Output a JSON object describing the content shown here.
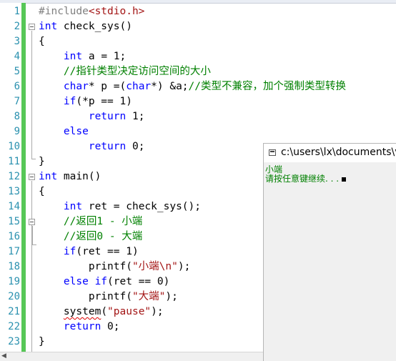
{
  "editor": {
    "line_numbers": [
      "1",
      "2",
      "3",
      "4",
      "5",
      "6",
      "7",
      "8",
      "9",
      "10",
      "11",
      "12",
      "13",
      "14",
      "15",
      "16",
      "17",
      "18",
      "19",
      "20",
      "21",
      "22",
      "23"
    ],
    "lines": [
      [
        {
          "t": "#include",
          "c": "pp"
        },
        {
          "t": "<stdio.h>",
          "c": "str"
        }
      ],
      [
        {
          "t": "int",
          "c": "kw"
        },
        {
          "t": " check_sys()",
          "c": ""
        }
      ],
      [
        {
          "t": "{",
          "c": ""
        }
      ],
      [
        {
          "t": "    ",
          "c": ""
        },
        {
          "t": "int",
          "c": "kw"
        },
        {
          "t": " a = 1;",
          "c": ""
        }
      ],
      [
        {
          "t": "    //指针类型决定访问空间的大小",
          "c": "cm"
        }
      ],
      [
        {
          "t": "    ",
          "c": ""
        },
        {
          "t": "char",
          "c": "kw"
        },
        {
          "t": "* p =(",
          "c": ""
        },
        {
          "t": "char",
          "c": "kw"
        },
        {
          "t": "*) &a;",
          "c": ""
        },
        {
          "t": "//类型不兼容，加个强制类型转换",
          "c": "cm"
        }
      ],
      [
        {
          "t": "    ",
          "c": ""
        },
        {
          "t": "if",
          "c": "kw"
        },
        {
          "t": "(*p == 1)",
          "c": ""
        }
      ],
      [
        {
          "t": "        ",
          "c": ""
        },
        {
          "t": "return",
          "c": "kw"
        },
        {
          "t": " 1;",
          "c": ""
        }
      ],
      [
        {
          "t": "    ",
          "c": ""
        },
        {
          "t": "else",
          "c": "kw"
        }
      ],
      [
        {
          "t": "        ",
          "c": ""
        },
        {
          "t": "return",
          "c": "kw"
        },
        {
          "t": " 0;",
          "c": ""
        }
      ],
      [
        {
          "t": "}",
          "c": ""
        }
      ],
      [
        {
          "t": "int",
          "c": "kw"
        },
        {
          "t": " main()",
          "c": ""
        }
      ],
      [
        {
          "t": "{",
          "c": ""
        }
      ],
      [
        {
          "t": "    ",
          "c": ""
        },
        {
          "t": "int",
          "c": "kw"
        },
        {
          "t": " ret = check_sys();",
          "c": ""
        }
      ],
      [
        {
          "t": "    //返回1 - 小端",
          "c": "cm"
        }
      ],
      [
        {
          "t": "    //返回0 - 大端",
          "c": "cm"
        }
      ],
      [
        {
          "t": "    ",
          "c": ""
        },
        {
          "t": "if",
          "c": "kw"
        },
        {
          "t": "(ret == 1)",
          "c": ""
        }
      ],
      [
        {
          "t": "        printf(",
          "c": ""
        },
        {
          "t": "\"小端\\n\"",
          "c": "str"
        },
        {
          "t": ");",
          "c": ""
        }
      ],
      [
        {
          "t": "    ",
          "c": ""
        },
        {
          "t": "else",
          "c": "kw"
        },
        {
          "t": " ",
          "c": ""
        },
        {
          "t": "if",
          "c": "kw"
        },
        {
          "t": "(ret == 0)",
          "c": ""
        }
      ],
      [
        {
          "t": "        printf(",
          "c": ""
        },
        {
          "t": "\"大端\"",
          "c": "str"
        },
        {
          "t": ");",
          "c": ""
        }
      ],
      [
        {
          "t": "    ",
          "c": ""
        },
        {
          "t": "system",
          "c": "squig"
        },
        {
          "t": "(",
          "c": ""
        },
        {
          "t": "\"pause\"",
          "c": "str"
        },
        {
          "t": ");",
          "c": ""
        }
      ],
      [
        {
          "t": "    ",
          "c": ""
        },
        {
          "t": "return",
          "c": "kw"
        },
        {
          "t": " 0;",
          "c": ""
        }
      ],
      [
        {
          "t": "}",
          "c": ""
        }
      ]
    ]
  },
  "console": {
    "title": "c:\\users\\lx\\documents\\v",
    "output_line1": "小端",
    "output_line2": "请按任意键继续. . ."
  },
  "colors": {
    "keyword": "#0000ff",
    "comment": "#008000",
    "string": "#a31515",
    "preprocessor": "#808080",
    "line_number": "#2b91af",
    "change_bar": "#57c757",
    "console_text": "#008000"
  }
}
